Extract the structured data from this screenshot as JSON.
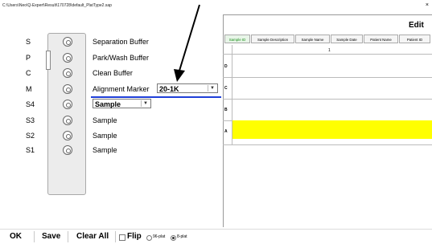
{
  "window": {
    "path": "C:\\Users\\Neo\\Q-Expert\\Result\\170728\\default_PlatType2.sap",
    "close_glyph": "×"
  },
  "edit_label": "Edit",
  "rows": [
    {
      "code": "S",
      "text": "Separation Buffer"
    },
    {
      "code": "P",
      "text": "Park/Wash Buffer"
    },
    {
      "code": "C",
      "text": "Clean Buffer"
    },
    {
      "code": "M",
      "text": "Alignment Marker",
      "select_value": "20-1K"
    },
    {
      "code": "S4",
      "select_value": "Sample"
    },
    {
      "code": "S3",
      "text": "Sample"
    },
    {
      "code": "S2",
      "text": "Sample"
    },
    {
      "code": "S1",
      "text": "Sample"
    }
  ],
  "tabs": [
    "Sample ID",
    "Sample Description",
    "Sample Name",
    "Sample Date",
    "Patient Name",
    "Patient ID"
  ],
  "grid": {
    "column": "1",
    "row_labels": [
      "D",
      "C",
      "B",
      "A"
    ],
    "highlight_color": "#ffff00"
  },
  "bottom": {
    "ok": "OK",
    "save": "Save",
    "clear_all": "Clear All",
    "flip": "Flip",
    "option_96": "96-plat",
    "option_8": "8-plat"
  },
  "accent_color": "#1f3fd8"
}
